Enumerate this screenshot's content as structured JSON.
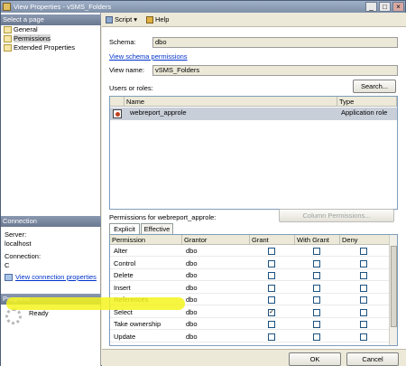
{
  "window": {
    "title": "View Properties - vSMS_Folders",
    "min_label": "_",
    "max_label": "□",
    "close_label": "×"
  },
  "left": {
    "select_page_header": "Select a page",
    "pages": [
      "General",
      "Permissions",
      "Extended Properties"
    ],
    "connection_header": "Connection",
    "server_label": "Server:",
    "server_value": "localhost",
    "connection_label": "Connection:",
    "connection_value": "C",
    "view_connection_link": "View connection properties",
    "progress_header": "Progress",
    "progress_status": "Ready"
  },
  "toolbar": {
    "script_label": "Script",
    "help_label": "Help"
  },
  "form": {
    "schema_label": "Schema:",
    "schema_value": "dbo",
    "view_schema_link": "View schema permissions",
    "view_name_label": "View name:",
    "view_name_value": "vSMS_Folders",
    "users_label": "Users or roles:",
    "search_button": "Search...",
    "users_columns": [
      "Name",
      "Type"
    ],
    "users_rows": [
      {
        "name": "webreport_approle",
        "type": "Application role"
      }
    ],
    "perms_for_label": "Permissions for webreport_approle:",
    "column_permissions_button": "Column Permissions...",
    "tabs": [
      "Explicit",
      "Effective"
    ],
    "perm_columns": [
      "Permission",
      "Grantor",
      "Grant",
      "With Grant",
      "Deny"
    ],
    "perm_rows": [
      {
        "permission": "Alter",
        "grantor": "dbo",
        "grant": false,
        "with_grant": false,
        "deny": false
      },
      {
        "permission": "Control",
        "grantor": "dbo",
        "grant": false,
        "with_grant": false,
        "deny": false
      },
      {
        "permission": "Delete",
        "grantor": "dbo",
        "grant": false,
        "with_grant": false,
        "deny": false
      },
      {
        "permission": "Insert",
        "grantor": "dbo",
        "grant": false,
        "with_grant": false,
        "deny": false
      },
      {
        "permission": "References",
        "grantor": "dbo",
        "grant": false,
        "with_grant": false,
        "deny": false
      },
      {
        "permission": "Select",
        "grantor": "dbo",
        "grant": true,
        "with_grant": false,
        "deny": false
      },
      {
        "permission": "Take ownership",
        "grantor": "dbo",
        "grant": false,
        "with_grant": false,
        "deny": false
      },
      {
        "permission": "Update",
        "grantor": "dbo",
        "grant": false,
        "with_grant": false,
        "deny": false
      }
    ],
    "highlight_color": "#f5f51e"
  },
  "buttons": {
    "ok": "OK",
    "cancel": "Cancel"
  }
}
